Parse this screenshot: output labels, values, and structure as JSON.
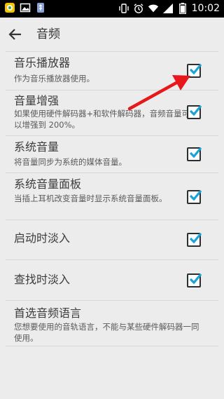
{
  "status_bar": {
    "time": "10:02",
    "left_icons": [
      "app-notification-icon",
      "image-icon",
      "usb-icon"
    ],
    "right_icons": [
      "vibrate-icon",
      "alarm-icon",
      "wifi-icon",
      "signal-icon",
      "battery-icon"
    ]
  },
  "header": {
    "title": "音频"
  },
  "settings": [
    {
      "title": "音乐播放器",
      "subtitle": "作为音乐播放器使用。",
      "checked": true
    },
    {
      "title": "音量增强",
      "subtitle": "如果使用硬件解码器+和软件解码器，音频音量可以增强到 200%。",
      "checked": true
    },
    {
      "title": "系统音量",
      "subtitle": "将音量同步为系统的媒体音量。",
      "checked": true
    },
    {
      "title": "系统音量面板",
      "subtitle": "当插上耳机改变音量时显示系统音量面板。",
      "checked": true
    },
    {
      "title": "启动时淡入",
      "subtitle": "",
      "checked": true
    },
    {
      "title": "查找时淡入",
      "subtitle": "",
      "checked": true
    },
    {
      "title": "首选音频语言",
      "subtitle": "您想要使用的音轨语言，不能与某些硬件解码器一同使用。"
    }
  ],
  "annotation": {
    "color": "#e8171b"
  },
  "colors": {
    "check_accent": "#1aa3d9"
  }
}
